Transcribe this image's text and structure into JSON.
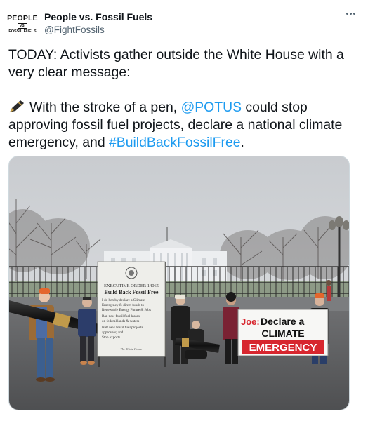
{
  "account": {
    "display_name": "People vs. Fossil Fuels",
    "handle": "@FightFossils",
    "avatar_line1": "PEOPLE",
    "avatar_line2": "VS.",
    "avatar_line3": "FOSSIL FUELS"
  },
  "tweet": {
    "line1": "TODAY: Activists gather outside the White House with a very clear message:",
    "line2_pre": "With the stroke of a pen, ",
    "mention": "@POTUS",
    "line2_mid": " could stop approving fossil fuel projects, declare a national climate emergency, and ",
    "hashtag": "#BuildBackFossilFree",
    "line2_end": "."
  },
  "media": {
    "sign_left": {
      "line1": "EXECUTIVE ORDER 14065",
      "title": "Build Back Fossil Free",
      "items": [
        "I do hereby declare a Climate",
        "Emergency & direct funds to",
        "Renewable Energy Future & Jobs",
        "Ban new fossil fuel leases",
        "on federal lands & waters",
        "Halt new fossil fuel projects",
        "approvals; and",
        "Stop exports"
      ],
      "signature": "The White House"
    },
    "sign_right": {
      "line1": "Declare a",
      "line2": "CLIMATE",
      "line3": "EMERGENCY",
      "prefix": "Joe:"
    }
  },
  "colors": {
    "link": "#1d9bf0",
    "text": "#0f1419",
    "secondary": "#536471",
    "sign_red": "#d7262e"
  }
}
